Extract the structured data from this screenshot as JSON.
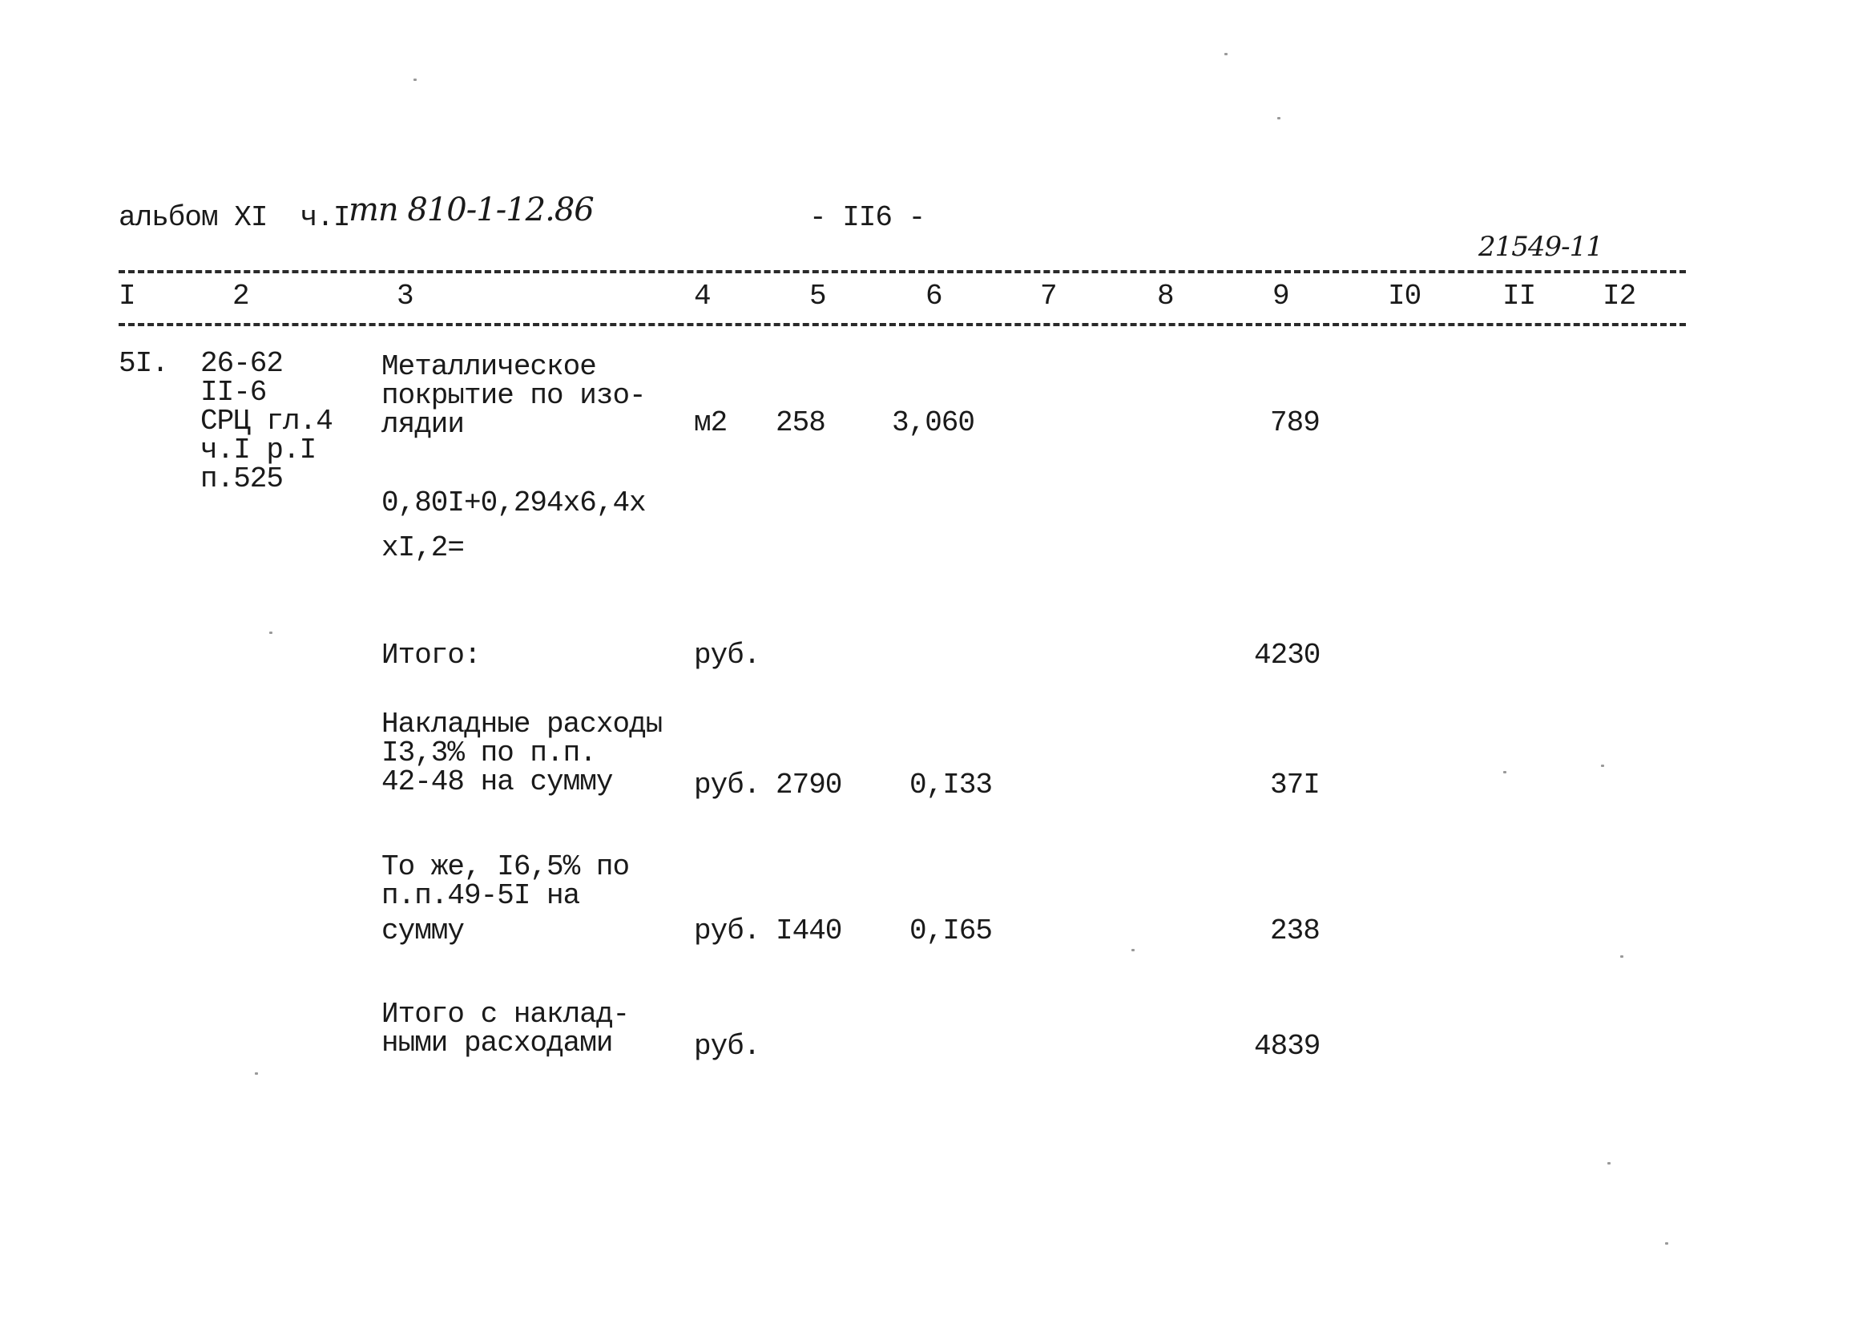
{
  "header": {
    "album": "альбом XI  ч.I",
    "project_code_handwritten": "тп 810-1-12.86",
    "page_number": "- II6 -",
    "doc_number_handwritten": "21549-11"
  },
  "table": {
    "columns": [
      "I",
      "2",
      "3",
      "4",
      "5",
      "6",
      "7",
      "8",
      "9",
      "I0",
      "II",
      "I2"
    ],
    "rows": [
      {
        "num": "5I.",
        "ref": [
          "26-62",
          "II-6",
          "СРЦ гл.4",
          "ч.I р.I",
          "п.525"
        ],
        "desc": [
          "Металлическое",
          "покрытие по изо-",
          "лядии"
        ],
        "unit": "м2",
        "qty": "258",
        "price": "3,060",
        "total": "789",
        "formula": [
          "0,80I+0,294x6,4x",
          "xI,2="
        ]
      },
      {
        "desc": [
          "Итого:"
        ],
        "unit": "руб.",
        "total": "4230"
      },
      {
        "desc": [
          "Накладные расходы",
          "I3,3% по п.п.",
          "42-48 на сумму"
        ],
        "unit": "руб.",
        "qty": "2790",
        "price": "0,I33",
        "total": "37I"
      },
      {
        "desc": [
          "То же, I6,5% по",
          "п.п.49-5I на",
          "сумму"
        ],
        "unit": "руб.",
        "qty": "I440",
        "price": "0,I65",
        "total": "238"
      },
      {
        "desc": [
          "Итого с наклад-",
          "ными расходами"
        ],
        "unit": "руб.",
        "total": "4839"
      }
    ]
  }
}
